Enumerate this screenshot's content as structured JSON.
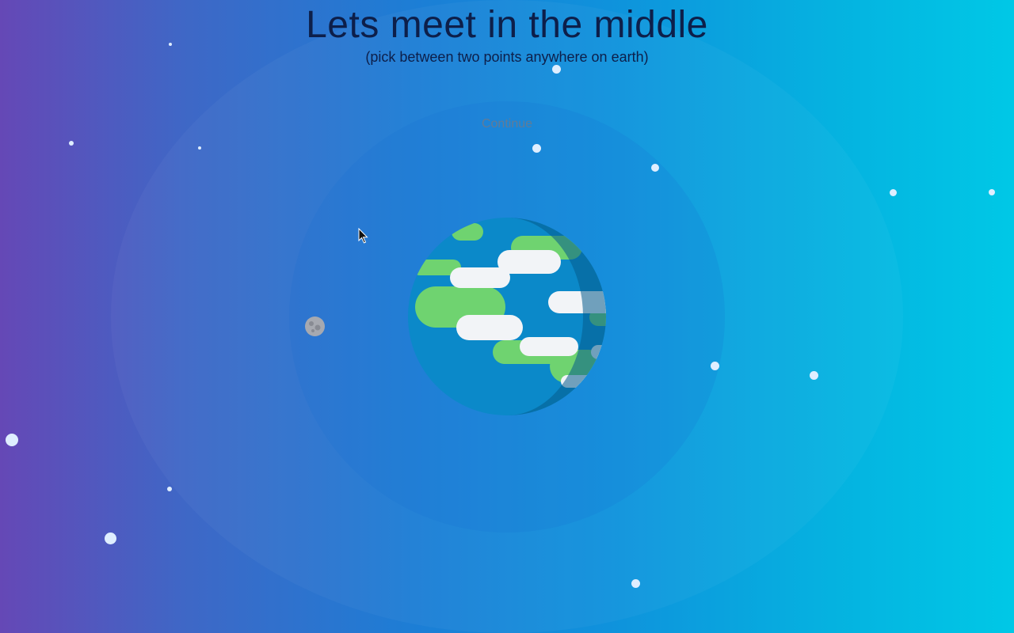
{
  "header": {
    "title": "Lets meet in the middle",
    "subtitle": "(pick between two points anywhere on earth)"
  },
  "actions": {
    "continue_label": "Continue"
  },
  "scene": {
    "earth_icon": "earth-icon",
    "moon_icon": "moon-icon",
    "colors": {
      "ocean": "#0b89c9",
      "ocean_shadow": "#0868a0",
      "land": "#6fd370",
      "cloud": "#f2f4f7",
      "star": "#dfeeff",
      "title": "#0d1f4a"
    }
  }
}
